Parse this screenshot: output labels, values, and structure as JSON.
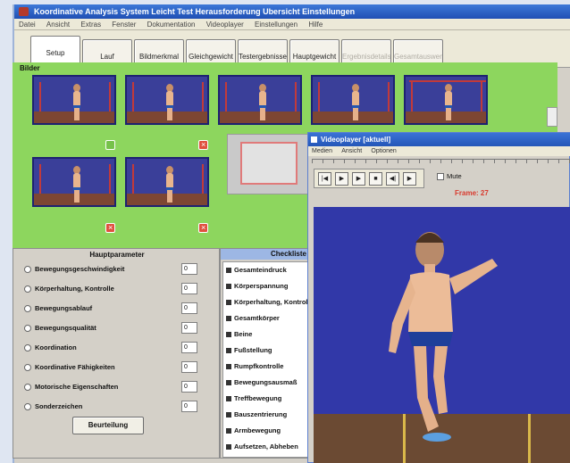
{
  "app": {
    "title": "Koordinative Analysis System   Leicht Test   Herausforderung   Ubersicht   Einstellungen",
    "menu": [
      "Datei",
      "Ansicht",
      "Extras",
      "Fenster",
      "Dokumentation",
      "Videoplayer",
      "Einstellungen",
      "Hilfe"
    ]
  },
  "nav": {
    "buttons": [
      {
        "label": "Setup",
        "state": "active"
      },
      {
        "label": "Lauf",
        "state": "normal"
      },
      {
        "label": "Bildmerkmal",
        "state": "normal"
      },
      {
        "label": "Gleichgewicht",
        "state": "normal"
      },
      {
        "label": "Testergebnisse",
        "state": "normal"
      },
      {
        "label": "Hauptgewicht",
        "state": "normal"
      },
      {
        "label": "Ergebnisdetails",
        "state": "disabled"
      },
      {
        "label": "Gesamtauswertung",
        "state": "disabled"
      }
    ]
  },
  "pictures": {
    "label": "Bilder",
    "thumb_count": 7,
    "marks": [
      "ok",
      "x",
      "x",
      "x"
    ]
  },
  "hauptparameter": {
    "title": "Hauptparameter",
    "rows": [
      {
        "label": "Bewegungsgeschwindigkeit",
        "value": "0"
      },
      {
        "label": "Körperhaltung, Kontrolle",
        "value": "0"
      },
      {
        "label": "Bewegungsablauf",
        "value": "0"
      },
      {
        "label": "Bewegungsqualität",
        "value": "0"
      },
      {
        "label": "Koordination",
        "value": "0"
      },
      {
        "label": "Koordinative Fähigkeiten",
        "value": "0"
      },
      {
        "label": "Motorische Eigenschaften",
        "value": "0"
      },
      {
        "label": "Sonderzeichen",
        "value": "0"
      }
    ],
    "button_label": "Beurteilung"
  },
  "checklist": {
    "title": "Checkliste",
    "items": [
      "Gesamteindruck",
      "Körperspannung",
      "Körperhaltung, Kontrolle",
      "Gesamtkörper",
      "Beine",
      "Fußstellung",
      "Rumpfkontrolle",
      "Bewegungsausmaß",
      "Treffbewegung",
      "Bauszentrierung",
      "Armbewegung",
      "Aufsetzen, Abheben"
    ]
  },
  "videoplayer": {
    "title": "Videoplayer [aktuell]",
    "menu": [
      "Medien",
      "Ansicht",
      "Optionen"
    ],
    "controls": [
      "|◀",
      "▶",
      "▶",
      "■",
      "◀|",
      "▶"
    ],
    "mute_label": "Mute",
    "frame_label": "Frame: 27"
  },
  "colors": {
    "accent_blue": "#2456b8",
    "panel_green": "#8dd65e",
    "frame_red": "#d83a2e"
  }
}
